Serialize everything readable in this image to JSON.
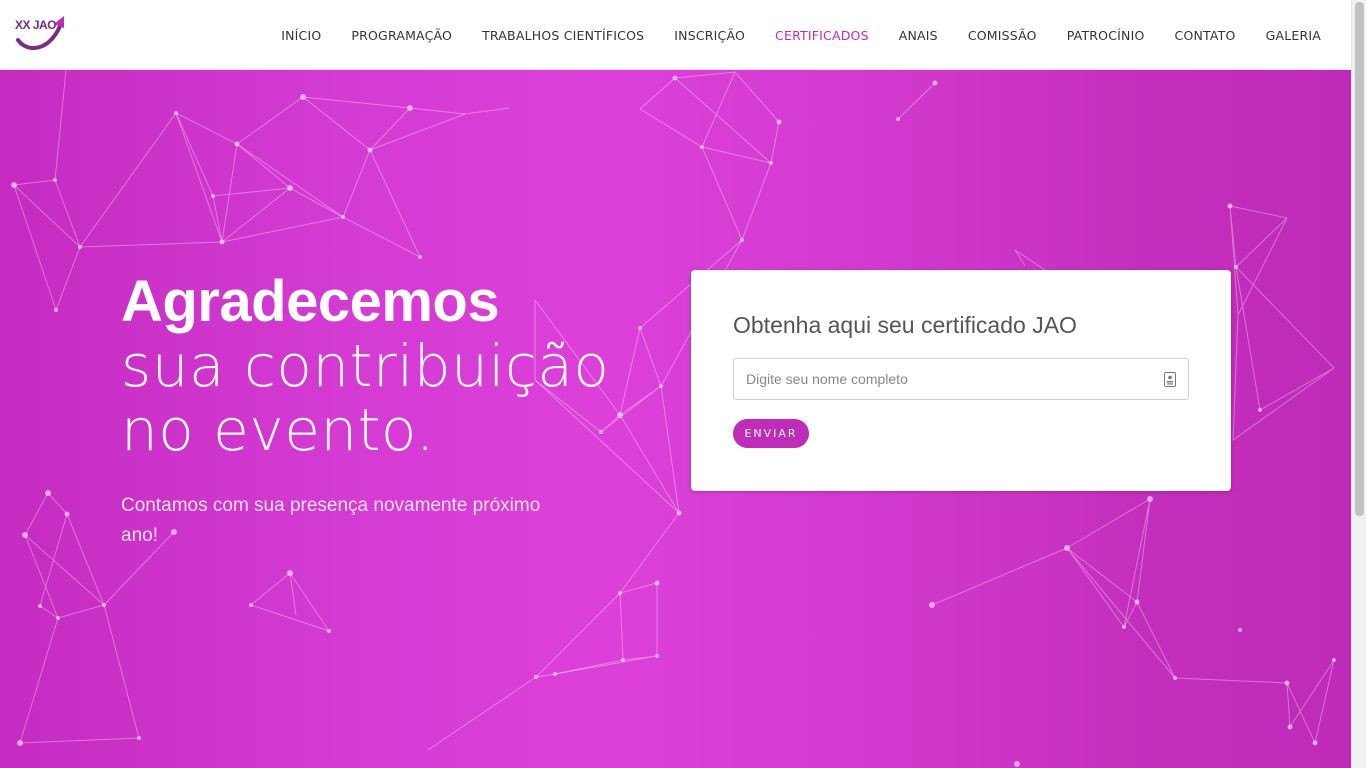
{
  "logo": {
    "text": "XX JAO"
  },
  "nav": {
    "items": [
      {
        "label": "INÍCIO"
      },
      {
        "label": "PROGRAMAÇÃO"
      },
      {
        "label": "TRABALHOS CIENTÍFICOS"
      },
      {
        "label": "INSCRIÇÃO"
      },
      {
        "label": "CERTIFICADOS"
      },
      {
        "label": "ANAIS"
      },
      {
        "label": "COMISSÃO"
      },
      {
        "label": "PATROCÍNIO"
      },
      {
        "label": "CONTATO"
      },
      {
        "label": "GALERIA"
      }
    ],
    "active": "CERTIFICADOS"
  },
  "hero": {
    "headline_bold": "Agradecemos",
    "headline_line2": "sua contribuição",
    "headline_line3": "no evento.",
    "subtitle": "Contamos com sua presença novamente próximo ano!"
  },
  "certificate_form": {
    "title": "Obtenha aqui seu certificado JAO",
    "name_value": "",
    "name_placeholder": "Digite seu nome completo",
    "submit_label": "ENVIAR"
  },
  "colors": {
    "accent": "#c02bb8",
    "hero_gradient_mid": "#dc40d9",
    "nav_text": "#333333"
  },
  "icons": {
    "input_icon": "id-card-icon",
    "logo_icon": "arrow-swoosh-icon"
  }
}
